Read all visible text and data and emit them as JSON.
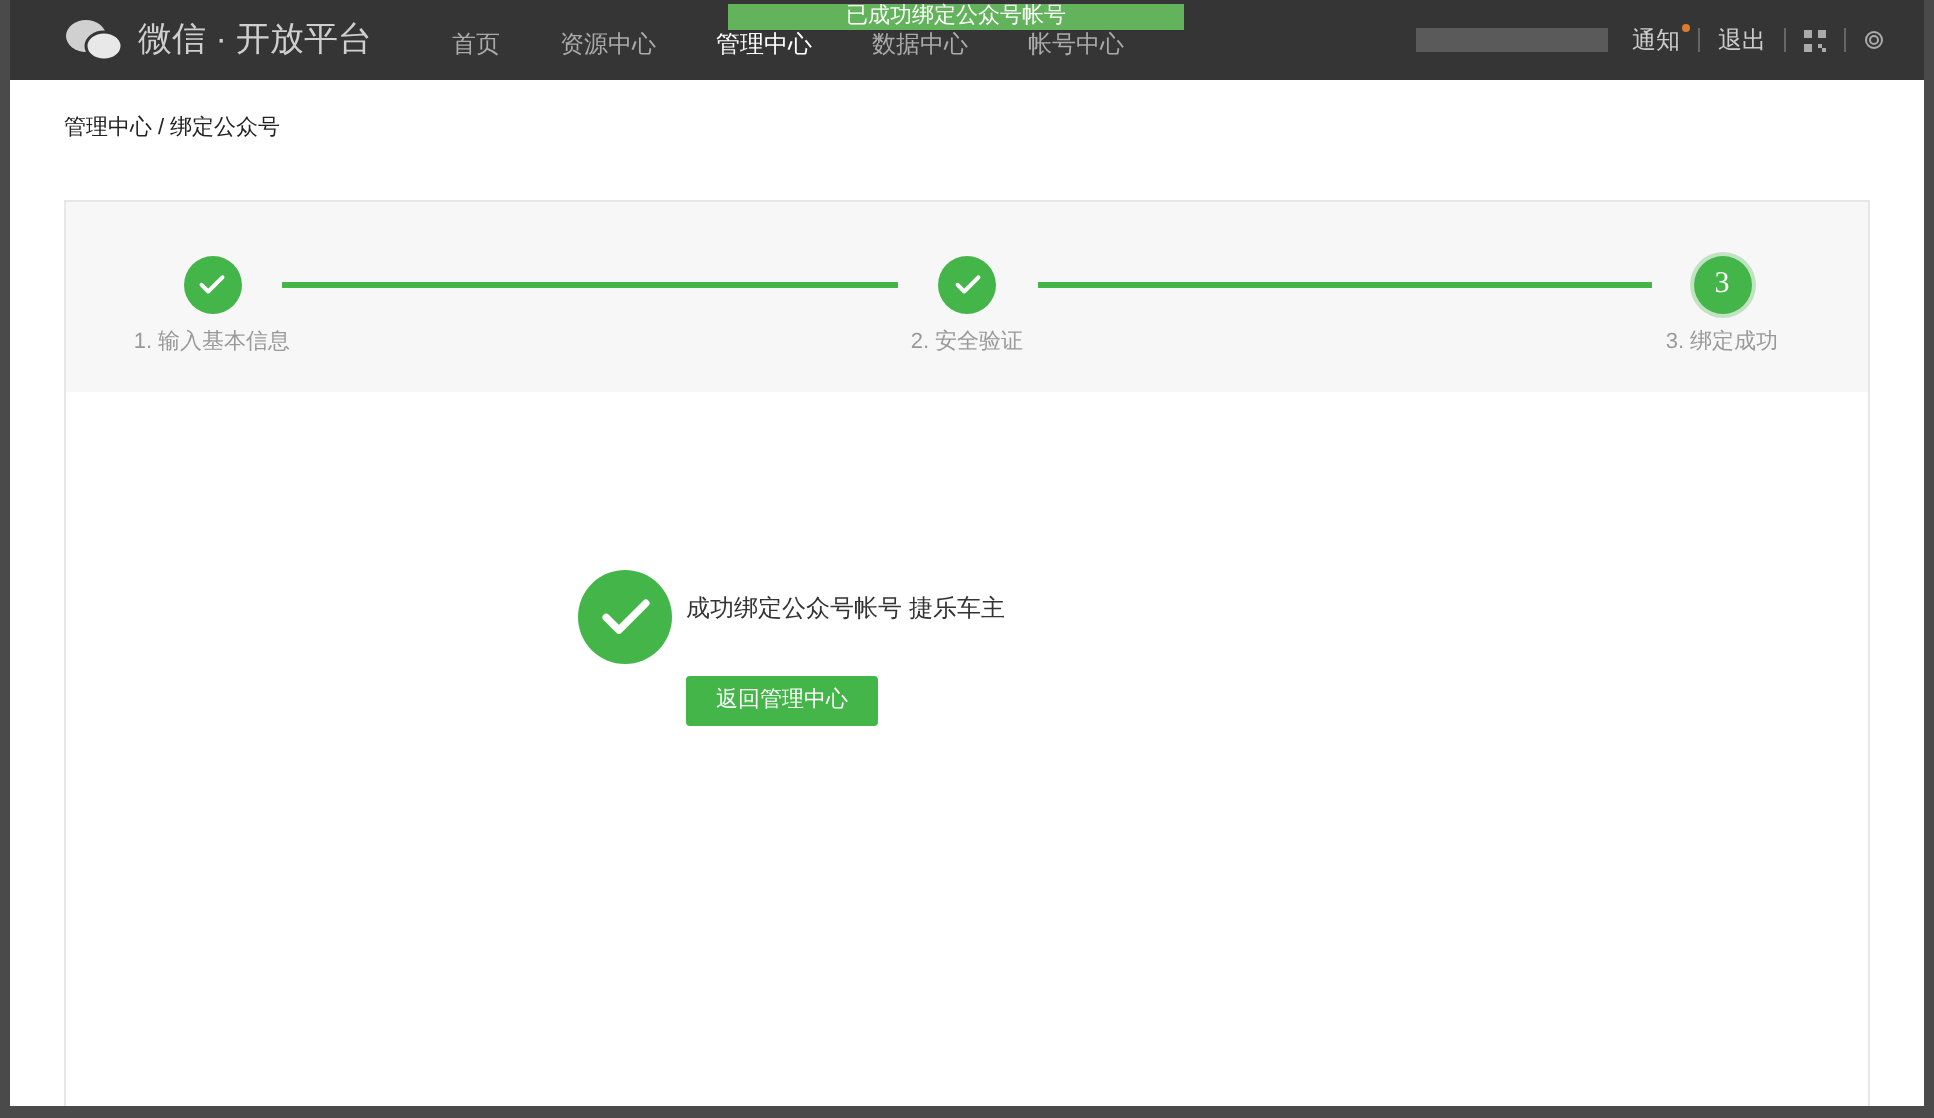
{
  "brand": {
    "title": "微信 · 开放平台"
  },
  "toast": {
    "text": "已成功绑定公众号帐号"
  },
  "nav": [
    {
      "label": "首页",
      "selected": false
    },
    {
      "label": "资源中心",
      "selected": false
    },
    {
      "label": "管理中心",
      "selected": true
    },
    {
      "label": "数据中心",
      "selected": false
    },
    {
      "label": "帐号中心",
      "selected": false
    }
  ],
  "user_menu": {
    "notice": {
      "label": "通知",
      "unread": true
    },
    "logout": "退出"
  },
  "breadcrumb": {
    "items": [
      "管理中心",
      "绑定公众号"
    ],
    "separator": "/"
  },
  "steps": [
    {
      "label": "1. 输入基本信息",
      "done": true
    },
    {
      "label": "2. 安全验证",
      "done": true
    },
    {
      "number": "3",
      "label": "3. 绑定成功",
      "done": false
    }
  ],
  "result": {
    "message": "成功绑定公众号帐号 捷乐车主",
    "button": "返回管理中心"
  }
}
